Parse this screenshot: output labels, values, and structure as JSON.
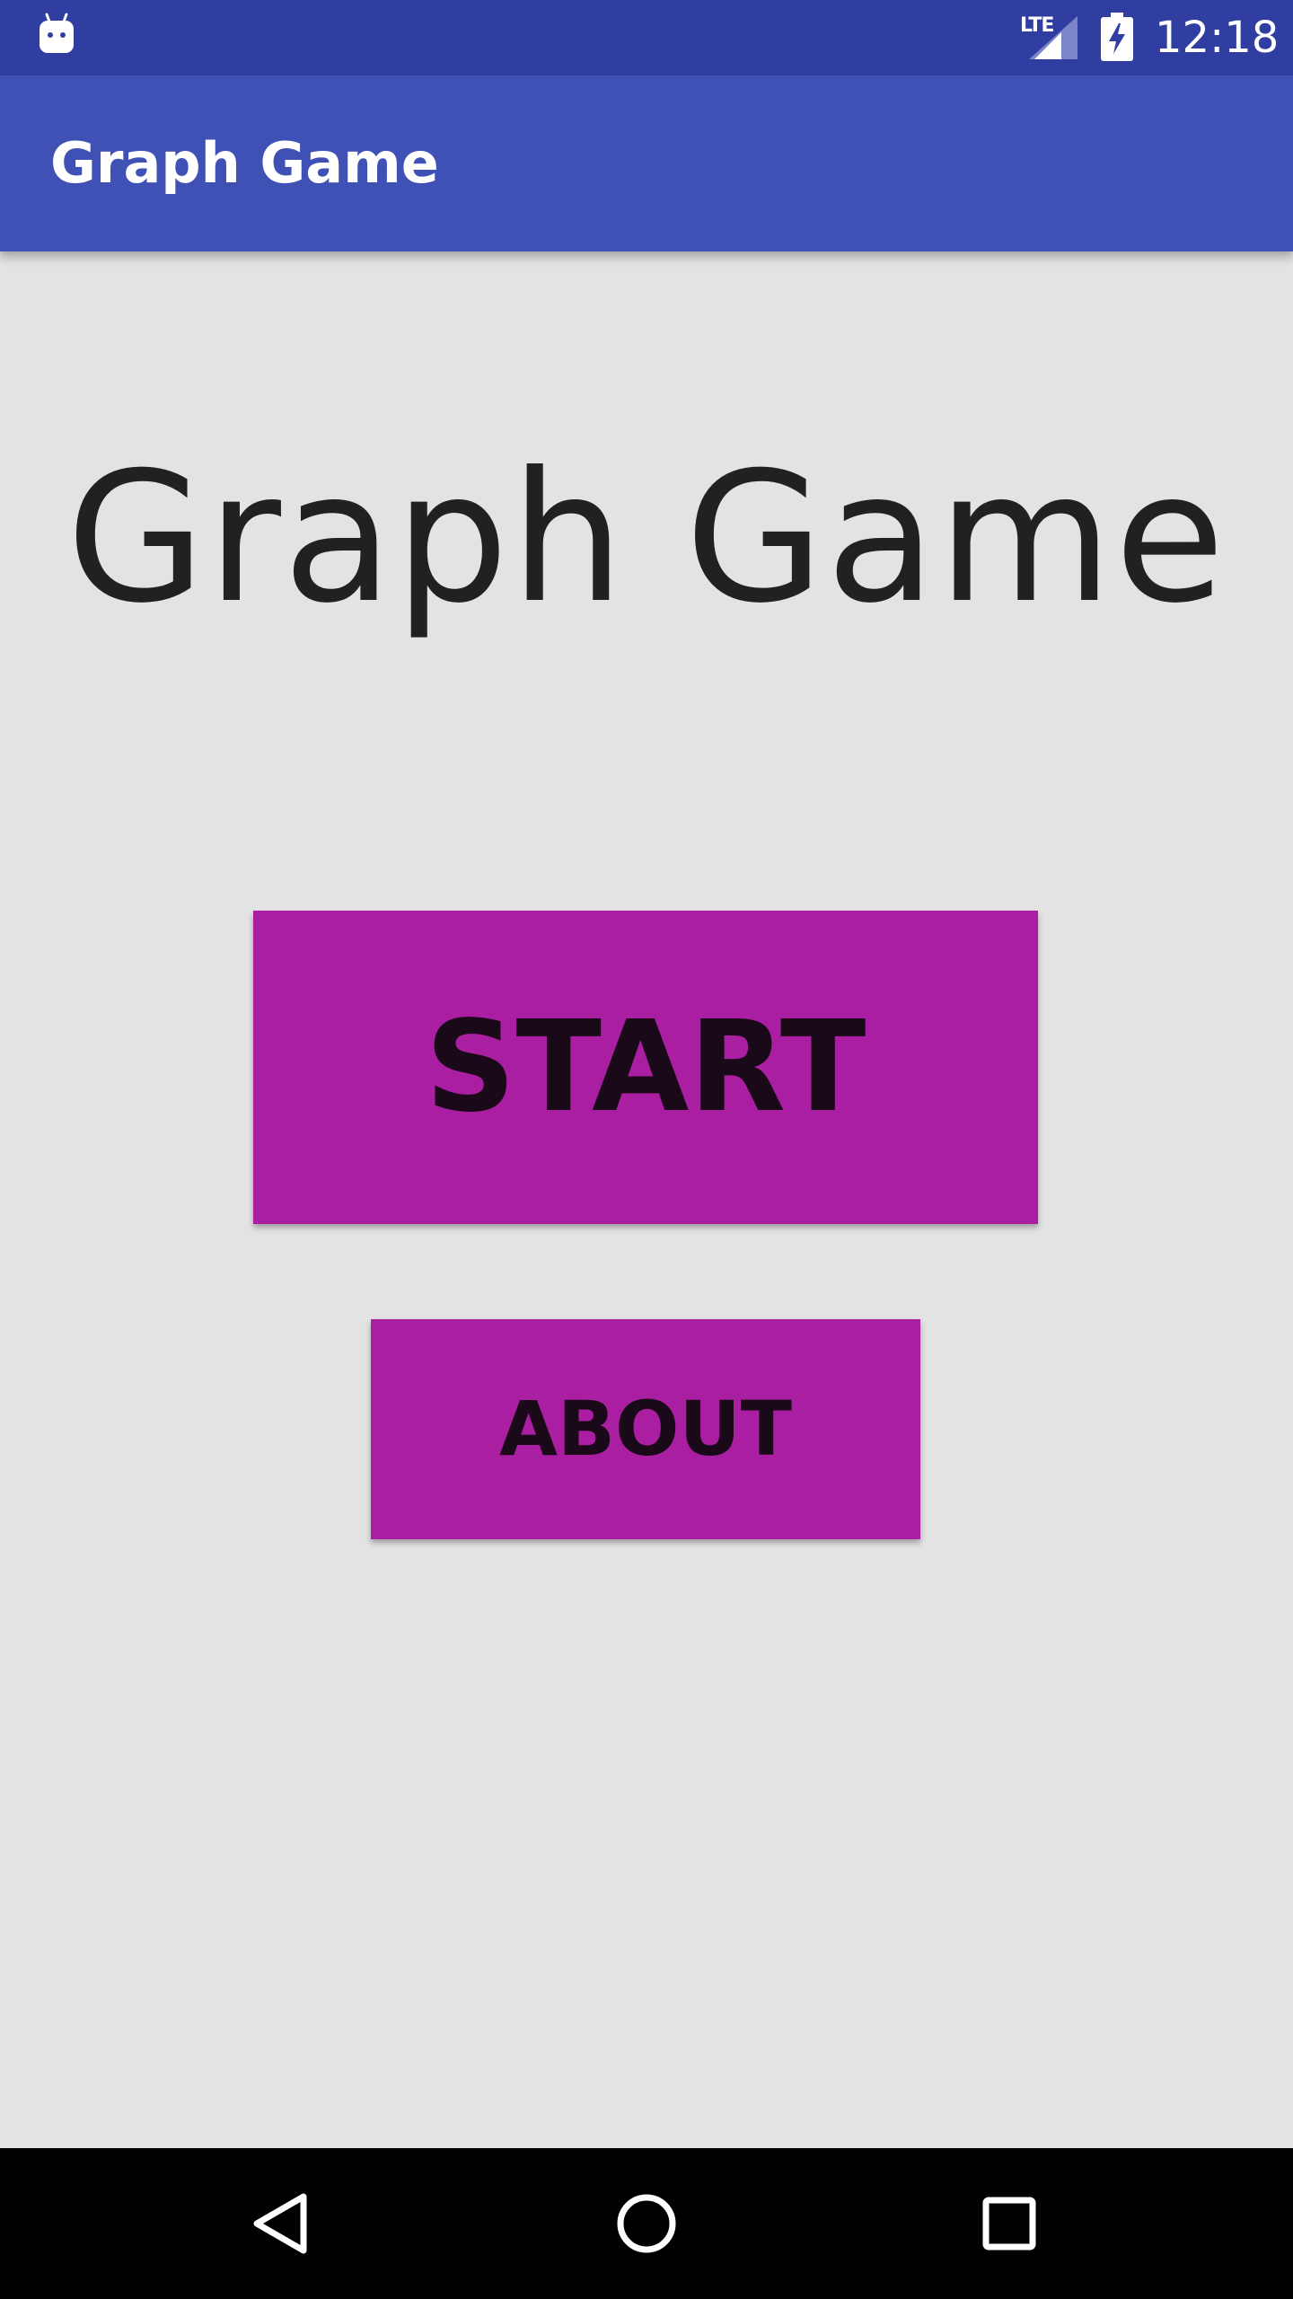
{
  "status_bar": {
    "network_label": "LTE",
    "time": "12:18",
    "icons": [
      "android-icon",
      "signal-icon",
      "battery-charging-icon"
    ]
  },
  "app_bar": {
    "title": "Graph Game"
  },
  "main": {
    "title": "Graph Game",
    "start_label": "START",
    "about_label": "ABOUT"
  },
  "nav_bar": {
    "icons": [
      "back-icon",
      "home-icon",
      "recents-icon"
    ]
  },
  "colors": {
    "status_bar": "#2f3ea0",
    "app_bar": "#3f51b5",
    "background": "#e3e3e3",
    "button": "#aa1fa1",
    "button_text": "#1a0a19",
    "title_text": "#212121",
    "nav_bar": "#000000"
  }
}
